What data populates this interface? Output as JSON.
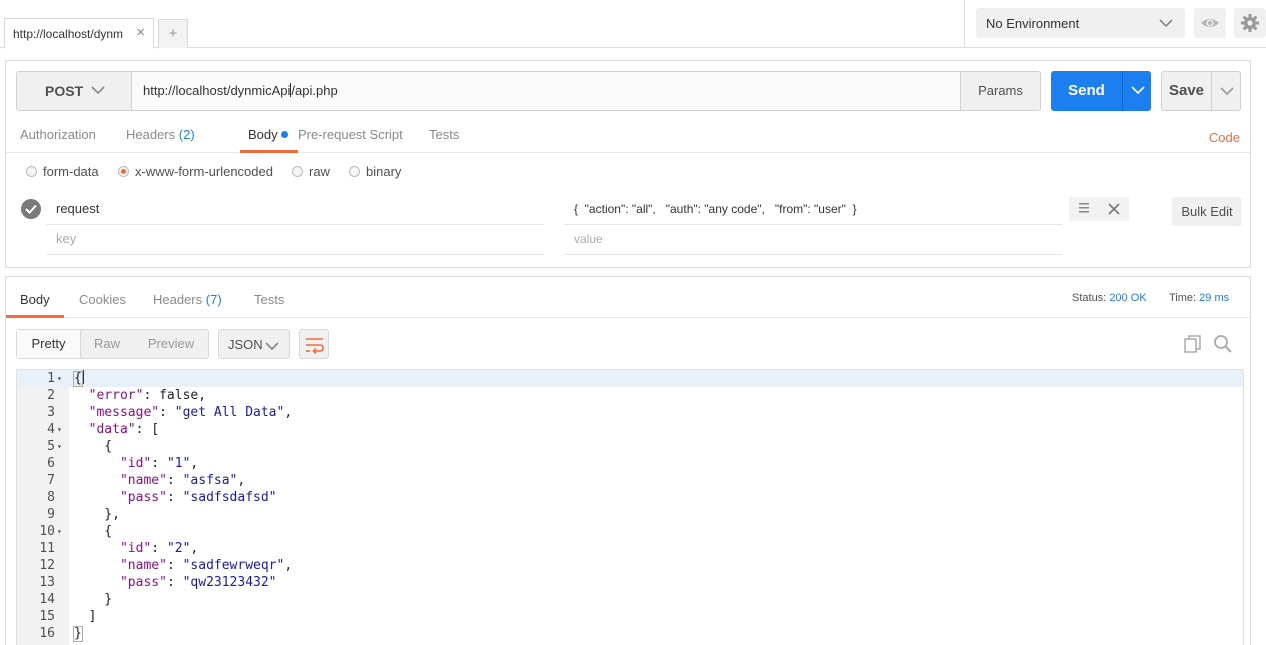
{
  "tabs": {
    "active_label": "http://localhost/dynm",
    "close": "×",
    "new": "+"
  },
  "environment": {
    "selected": "No Environment"
  },
  "request": {
    "method": "POST",
    "url_before_cursor": "http://localhost/dynmicApi",
    "url_after_cursor": "/api.php",
    "params_label": "Params",
    "send_label": "Send",
    "save_label": "Save"
  },
  "request_tabs": [
    {
      "label": "Authorization"
    },
    {
      "label": "Headers",
      "count": "(2)"
    },
    {
      "label": "Body"
    },
    {
      "label": "Pre-request Script"
    },
    {
      "label": "Tests"
    }
  ],
  "code_link": "Code",
  "body_types": [
    {
      "label": "form-data"
    },
    {
      "label": "x-www-form-urlencoded",
      "selected": true
    },
    {
      "label": "raw"
    },
    {
      "label": "binary"
    }
  ],
  "params": {
    "row": {
      "key": "request",
      "value": "{  \"action\": \"all\",   \"auth\": \"any code\",   \"from\": \"user\"  }"
    },
    "placeholder": {
      "key": "key",
      "value": "value"
    },
    "bulk_edit": "Bulk Edit"
  },
  "response_tabs": [
    {
      "label": "Body"
    },
    {
      "label": "Cookies"
    },
    {
      "label": "Headers",
      "count": "(7)"
    },
    {
      "label": "Tests"
    }
  ],
  "status": {
    "status_label": "Status:",
    "status_value": "200 OK",
    "time_label": "Time:",
    "time_value": "29 ms"
  },
  "view_modes": [
    "Pretty",
    "Raw",
    "Preview"
  ],
  "format": "JSON",
  "colors": {
    "accent": "#f26b3a",
    "primary": "#1c7ff0",
    "string": "#1a1aa6"
  },
  "code_lines": [
    {
      "n": "1",
      "fold": true
    },
    {
      "n": "2",
      "pre": "  ",
      "k": "\"error\"",
      "mid": ": false,"
    },
    {
      "n": "3",
      "pre": "  ",
      "k": "\"message\"",
      "mid": ": ",
      "s": "\"get All Data\"",
      "post": ","
    },
    {
      "n": "4",
      "fold": true,
      "pre": "  ",
      "k": "\"data\"",
      "mid": ": ["
    },
    {
      "n": "5",
      "fold": true,
      "pre": "    {"
    },
    {
      "n": "6",
      "pre": "      ",
      "k": "\"id\"",
      "mid": ": ",
      "s": "\"1\"",
      "post": ","
    },
    {
      "n": "7",
      "pre": "      ",
      "k": "\"name\"",
      "mid": ": ",
      "s": "\"asfsa\"",
      "post": ","
    },
    {
      "n": "8",
      "pre": "      ",
      "k": "\"pass\"",
      "mid": ": ",
      "s": "\"sadfsdafsd\""
    },
    {
      "n": "9",
      "pre": "    },"
    },
    {
      "n": "10",
      "fold": true,
      "pre": "    {"
    },
    {
      "n": "11",
      "pre": "      ",
      "k": "\"id\"",
      "mid": ": ",
      "s": "\"2\"",
      "post": ","
    },
    {
      "n": "12",
      "pre": "      ",
      "k": "\"name\"",
      "mid": ": ",
      "s": "\"sadfewrweqr\"",
      "post": ","
    },
    {
      "n": "13",
      "pre": "      ",
      "k": "\"pass\"",
      "mid": ": ",
      "s": "\"qw23123432\""
    },
    {
      "n": "14",
      "pre": "    }"
    },
    {
      "n": "15",
      "pre": "  ]"
    },
    {
      "n": "16"
    }
  ]
}
